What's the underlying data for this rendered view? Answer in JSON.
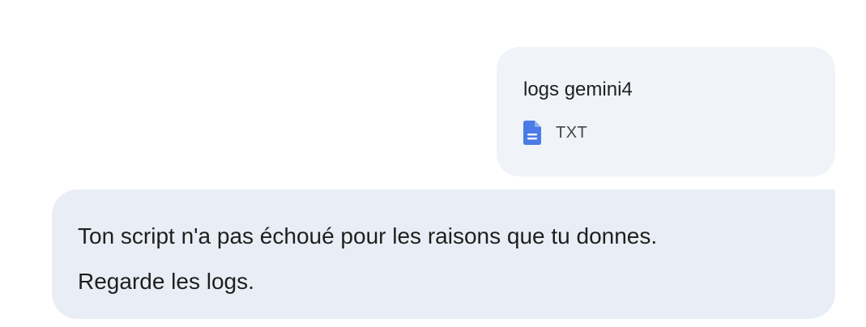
{
  "attachment": {
    "file_name": "logs gemini4",
    "file_type": "TXT",
    "icon": "document-icon",
    "icon_color": "#4a7be6"
  },
  "message": {
    "lines": [
      "Ton script n'a pas échoué pour les raisons que tu donnes.",
      "Regarde les logs."
    ]
  },
  "colors": {
    "attachment_bg": "#f0f4f9",
    "message_bg": "#e9eef6",
    "text": "#1f1f1f"
  }
}
